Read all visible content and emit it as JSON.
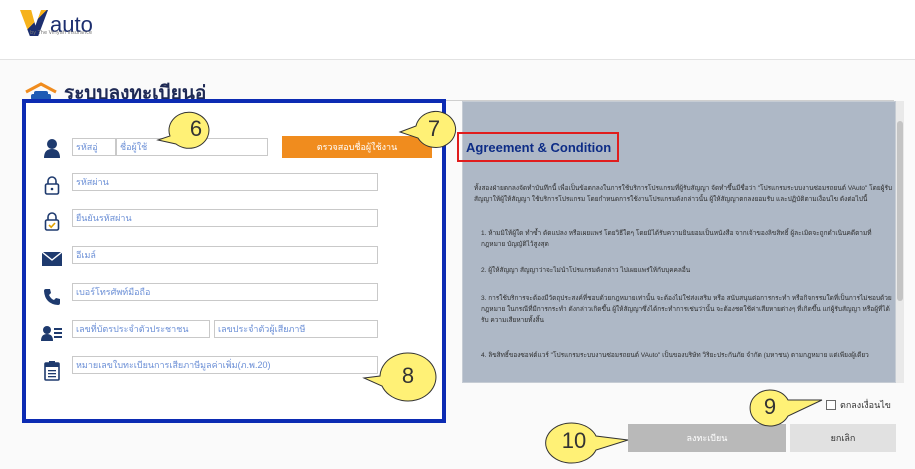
{
  "brand": {
    "logo_text": "auto",
    "logo_sub": "by The Viriyah Insurance"
  },
  "page": {
    "title": "ระบบลงทะเบียนอู่"
  },
  "form": {
    "user_code_placeholder": "รหัสอู่",
    "user_name_placeholder": "ชื่อผู้ใช้",
    "check_user_button": "ตรวจสอบชื่อผู้ใช้งาน",
    "password_placeholder": "รหัสผ่าน",
    "confirm_password_placeholder": "ยืนยันรหัสผ่าน",
    "email_placeholder": "อีเมล์",
    "phone_placeholder": "เบอร์โทรศัพท์มือถือ",
    "citizen_id_placeholder": "เลขที่บัตรประจำตัวประชาชน",
    "tax_id_placeholder": "เลขประจำตัวผู้เสียภาษี",
    "vat_reg_placeholder": "หมายเลขใบทะเบียนการเสียภาษีมูลค่าเพิ่ม(ภ.พ.20)"
  },
  "agreement": {
    "title": "Agreement & Condition",
    "intro": "ทั้งสองฝ่ายตกลงจัดทำบันทึกนี้ เพื่อเป็นข้อตกลงในการใช้บริการโปรแกรมที่ผู้รับสัญญา จัดทำขึ้นมีชื่อว่า \"โปรแกรมระบบงานซ่อมรถยนต์ VAuto\" โดยผู้รับสัญญาให้ผู้ให้สัญญา ใช้บริการโปรแกรม โดยกำหนดการใช้งานโปรแกรมดังกล่าวนั้น ผู้ให้สัญญาตกลงยอมรับ และปฏิบัติตามเงื่อนไข ดังต่อไปนี้",
    "item1": "1. ห้ามมิให้ผู้ใด ทำซ้ำ ดัดแปลง หรือเผยแพร่ โดยวิธีใดๆ โดยมิได้รับความยินยอมเป็นหนังสือ จากเจ้าของลิขสิทธิ์ ผู้ละเมิดจะถูกดำเนินคดีตามที่กฎหมาย บัญญัติไว้สูงสุด",
    "item2": "2. ผู้ให้สัญญา สัญญาว่าจะไม่นำโปรแกรมดังกล่าว ไปเผยแพร่ให้กับบุคคลอื่น",
    "item3": "3. การใช้บริการจะต้องมีวัตถุประสงค์ที่ชอบด้วยกฎหมายเท่านั้น จะต้องไม่ใช่ส่งเสริม หรือ สนับสนุนต่อการกระทำ หรือกิจกรรมใดที่เป็นการไม่ชอบด้วย กฎหมาย ในกรณีที่มีการกระทำ ดังกล่าวเกิดขึ้น ผู้ให้สัญญาซึ่งได้กระทำการเช่นว่านั้น จะต้องชดใช้ค่าเสียหายต่างๆ ที่เกิดขึ้น แก่ผู้รับสัญญา หรือผู้ที่ได้รับ ความเสียหายทั้งสิ้น",
    "item4": "4. ลิขสิทธิ์ของซอฟต์แวร์ \"โปรแกรมระบบงานซ่อมรถยนต์ VAuto\" เป็นของบริษัท วิริยะประกันภัย จำกัด (มหาชน) ตามกฎหมาย แต่เพียงผู้เดียว",
    "accept_label": "ตกลงเงื่อนไข"
  },
  "actions": {
    "register": "ลงทะเบียน",
    "cancel": "ยกเลิก"
  },
  "callouts": [
    "6",
    "7",
    "8",
    "9",
    "10"
  ],
  "colors": {
    "form_border": "#0c2bb3",
    "check_button": "#f08c1e",
    "callout_fill": "#fff176",
    "agreement_bg": "#aeb8c6",
    "title_box": "#e01d1d"
  }
}
